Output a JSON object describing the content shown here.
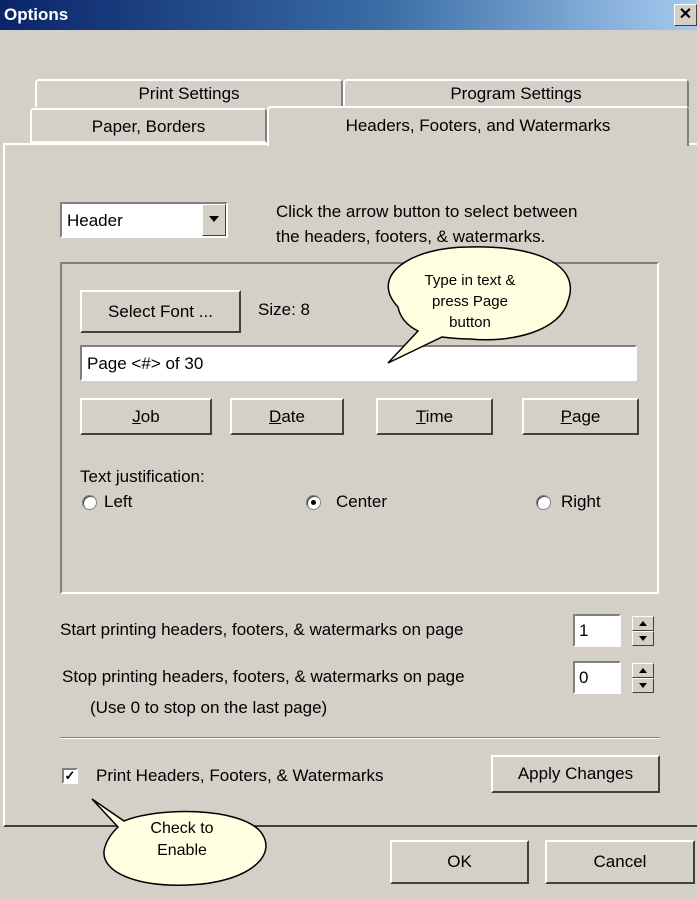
{
  "window": {
    "title": "Options",
    "close_glyph": "✕"
  },
  "tabs": {
    "print_settings": "Print Settings",
    "program_settings": "Program Settings",
    "paper_borders": "Paper, Borders",
    "headers_footers": "Headers, Footers, and Watermarks"
  },
  "selector": {
    "value": "Header",
    "hint_line1": "Click the arrow button to select between",
    "hint_line2": "the headers, footers, & watermarks."
  },
  "callout_top": {
    "line1": "Type in text &",
    "line2": "press Page",
    "line3": "button"
  },
  "font": {
    "button_label": "Select Font ...",
    "size_label": "Size: 8"
  },
  "text_field": {
    "value": "Page <#> of 30"
  },
  "insert_buttons": {
    "job": {
      "mnemonic": "J",
      "rest": "ob"
    },
    "date": {
      "mnemonic": "D",
      "rest": "ate"
    },
    "time": {
      "mnemonic": "T",
      "rest": "ime"
    },
    "page": {
      "mnemonic": "P",
      "rest": "age"
    }
  },
  "justification": {
    "label": "Text justification:",
    "left": "Left",
    "center": "Center",
    "right": "Right",
    "selected": "Center"
  },
  "start_page": {
    "label": "Start printing headers, footers, & watermarks on page",
    "value": "1"
  },
  "stop_page": {
    "label": "Stop printing headers, footers, & watermarks on page",
    "value": "0",
    "note": "(Use 0 to stop on the last page)"
  },
  "print_checkbox": {
    "label": "Print Headers, Footers, & Watermarks",
    "checked": true,
    "check_glyph": "✓"
  },
  "apply_button": "Apply Changes",
  "callout_bottom": {
    "line1": "Check to",
    "line2": "Enable"
  },
  "footer_buttons": {
    "ok": "OK",
    "cancel": "Cancel"
  },
  "colors": {
    "face": "#d4d0c8",
    "title_start": "#0a246a",
    "title_end": "#a6caf0",
    "callout_fill": "#ffffe1"
  }
}
